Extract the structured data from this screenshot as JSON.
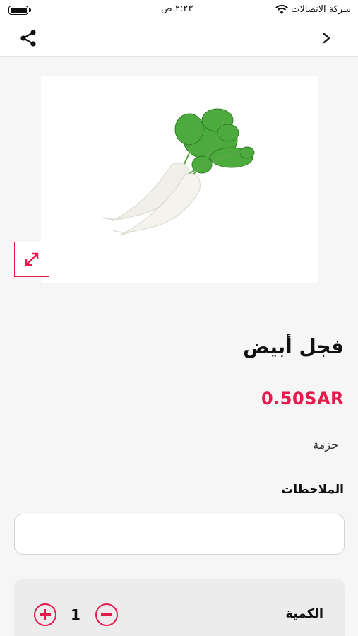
{
  "status_bar": {
    "carrier": "شركة الاتصالات",
    "time": "٢:٢٣ ص"
  },
  "nav": {
    "share_icon": "share-icon",
    "back_icon": "chevron-right-icon"
  },
  "product": {
    "image_subject": "white radish with green leaves",
    "name": "فجل أبيض",
    "price": "0.50SAR",
    "unit": "حزمة"
  },
  "notes": {
    "label": "الملاحظات",
    "value": "",
    "placeholder": ""
  },
  "quantity": {
    "label": "الكمية",
    "value": "1"
  },
  "colors": {
    "accent": "#e8194b",
    "background": "#f6f6f6"
  }
}
